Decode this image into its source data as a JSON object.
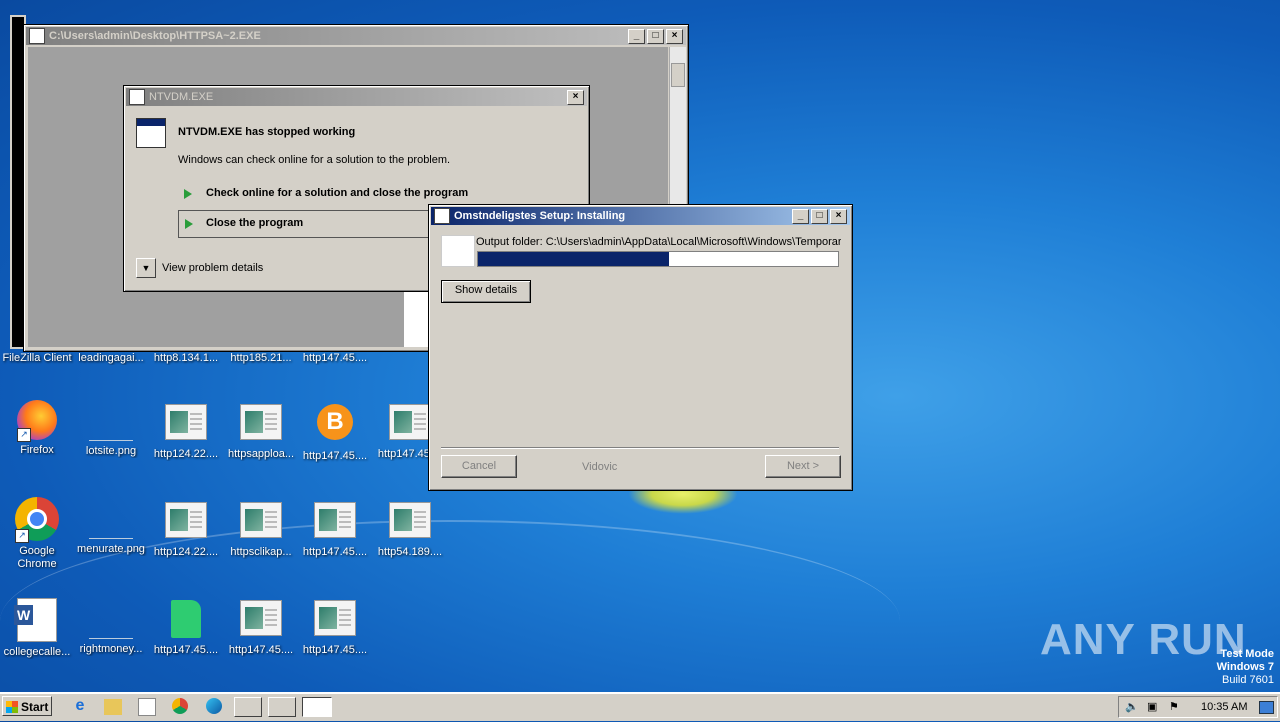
{
  "desktop": {
    "top_row_labels": [
      "FileZilla Client",
      "leadingagai...",
      "http8.134.1...",
      "http185.21...",
      "http147.45...."
    ],
    "icons": [
      {
        "label": "Firefox",
        "kind": "firefox-icon"
      },
      {
        "label": "lotsite.png",
        "kind": "image-file-icon"
      },
      {
        "label": "http124.22....",
        "kind": "web-file-icon"
      },
      {
        "label": "httpsapploa...",
        "kind": "web-file-icon"
      },
      {
        "label": "http147.45....",
        "kind": "bitcoin-icon"
      },
      {
        "label": "http147.45....",
        "kind": "web-file-icon"
      },
      {
        "label": "Google Chrome",
        "kind": "chrome-icon"
      },
      {
        "label": "menurate.png",
        "kind": "image-file-icon"
      },
      {
        "label": "http124.22....",
        "kind": "web-file-icon"
      },
      {
        "label": "httpsclikap...",
        "kind": "web-file-icon"
      },
      {
        "label": "http147.45....",
        "kind": "web-file-icon"
      },
      {
        "label": "http54.189....",
        "kind": "web-file-icon"
      },
      {
        "label": "collegecalle...",
        "kind": "word-doc-icon"
      },
      {
        "label": "rightmoney...",
        "kind": "image-file-icon"
      },
      {
        "label": "http147.45....",
        "kind": "leaf-file-icon"
      },
      {
        "label": "http147.45....",
        "kind": "web-file-icon"
      },
      {
        "label": "http147.45....",
        "kind": "web-file-icon"
      }
    ]
  },
  "console_window": {
    "title": "C:\\Users\\admin\\Desktop\\HTTPSA~2.EXE"
  },
  "ntvdm_dialog": {
    "title": "NTVDM.EXE",
    "heading": "NTVDM.EXE has stopped working",
    "message": "Windows can check online for a solution to the problem.",
    "option_check": "Check online for a solution and close the program",
    "option_close": "Close the program",
    "details_label": "View problem details"
  },
  "setup_window": {
    "title": "Omstndeligstes Setup: Installing",
    "output_folder": "Output folder: C:\\Users\\admin\\AppData\\Local\\Microsoft\\Windows\\Temporar",
    "progress": 0.53,
    "show_details": "Show details",
    "cancel": "Cancel",
    "brand": "Vidovic",
    "next": "Next >"
  },
  "taskbar": {
    "start": "Start",
    "clock": "10:35 AM"
  },
  "watermark": {
    "line1": "Test Mode",
    "line2": "Windows 7",
    "line3": "Build 7601",
    "logo": "ANY RUN"
  },
  "colors": {
    "title_active": "#0a246a",
    "progress_fill": "#0a246a",
    "desktop_blue": "#1f7fd6"
  }
}
